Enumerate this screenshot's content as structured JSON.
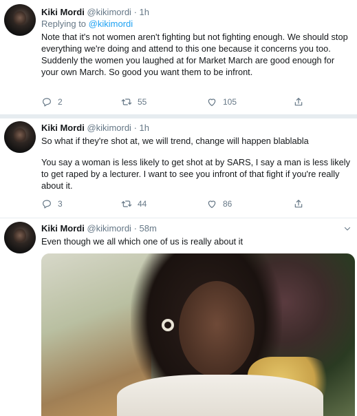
{
  "tweets": [
    {
      "name": "Kiki Mordi",
      "handle": "@kikimordi",
      "dot": "·",
      "time": "1h",
      "replying_prefix": "Replying to ",
      "replying_handle": "@kikimordi",
      "paragraphs": [
        "Note that it's not women aren't fighting but not fighting enough. We should stop everything we're doing and attend to this one because it concerns you too.",
        "Suddenly the women you laughed at for Market March are good enough for your own March. So good you want them to be infront."
      ],
      "replies": "2",
      "retweets": "55",
      "likes": "105"
    },
    {
      "name": "Kiki Mordi",
      "handle": "@kikimordi",
      "dot": "·",
      "time": "1h",
      "paragraphs": [
        "So what if they're shot at, we will trend, change will happen blablabla",
        "You say a woman is less likely to get shot at by SARS, I say a man is less likely to get raped by a lecturer. I want to see you infront of that fight if you're really about it."
      ],
      "replies": "3",
      "retweets": "44",
      "likes": "86"
    },
    {
      "name": "Kiki Mordi",
      "handle": "@kikimordi",
      "dot": "·",
      "time": "58m",
      "paragraphs": [
        "Even though we all which one of us is really about it"
      ]
    }
  ],
  "icons": {
    "reply": "reply-icon",
    "retweet": "retweet-icon",
    "like": "heart-icon",
    "share": "share-icon",
    "menu": "chevron-down-icon"
  },
  "colors": {
    "link": "#1da1f2",
    "secondary": "#657786",
    "divider": "#e6ecf0"
  }
}
